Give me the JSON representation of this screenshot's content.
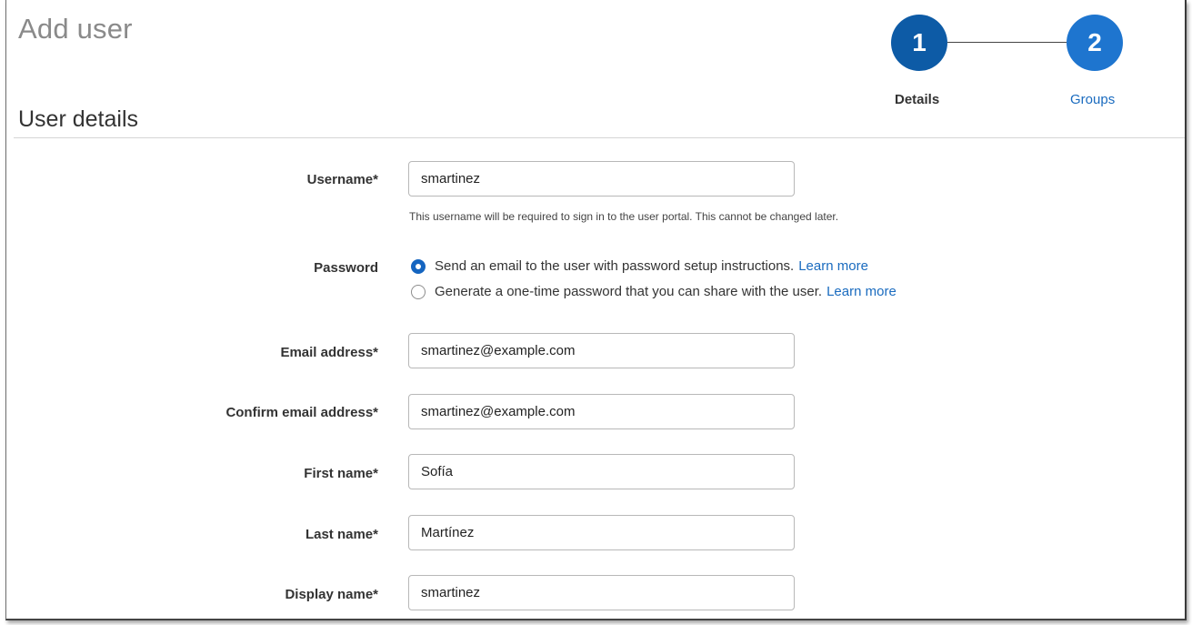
{
  "page": {
    "title": "Add user"
  },
  "wizard": {
    "steps": [
      {
        "number": "1",
        "label": "Details",
        "status": "current"
      },
      {
        "number": "2",
        "label": "Groups",
        "status": "next"
      }
    ]
  },
  "section": {
    "title": "User details"
  },
  "form": {
    "username": {
      "label": "Username*",
      "value": "smartinez",
      "hint": "This username will be required to sign in to the user portal. This cannot be changed later."
    },
    "password": {
      "label": "Password",
      "options": [
        {
          "text": "Send an email to the user with password setup instructions.",
          "link": "Learn more",
          "selected": true
        },
        {
          "text": "Generate a one-time password that you can share with the user.",
          "link": "Learn more",
          "selected": false
        }
      ]
    },
    "email": {
      "label": "Email address*",
      "value": "smartinez@example.com"
    },
    "confirm_email": {
      "label": "Confirm email address*",
      "value": "smartinez@example.com"
    },
    "first_name": {
      "label": "First name*",
      "value": "Sofía"
    },
    "last_name": {
      "label": "Last name*",
      "value": "Martínez"
    },
    "display_name": {
      "label": "Display name*",
      "value": "smartinez"
    }
  },
  "colors": {
    "step_current": "#0d5ba6",
    "step_next": "#1e75cf",
    "link": "#1a6bbf",
    "radio_selected": "#1565c0"
  }
}
